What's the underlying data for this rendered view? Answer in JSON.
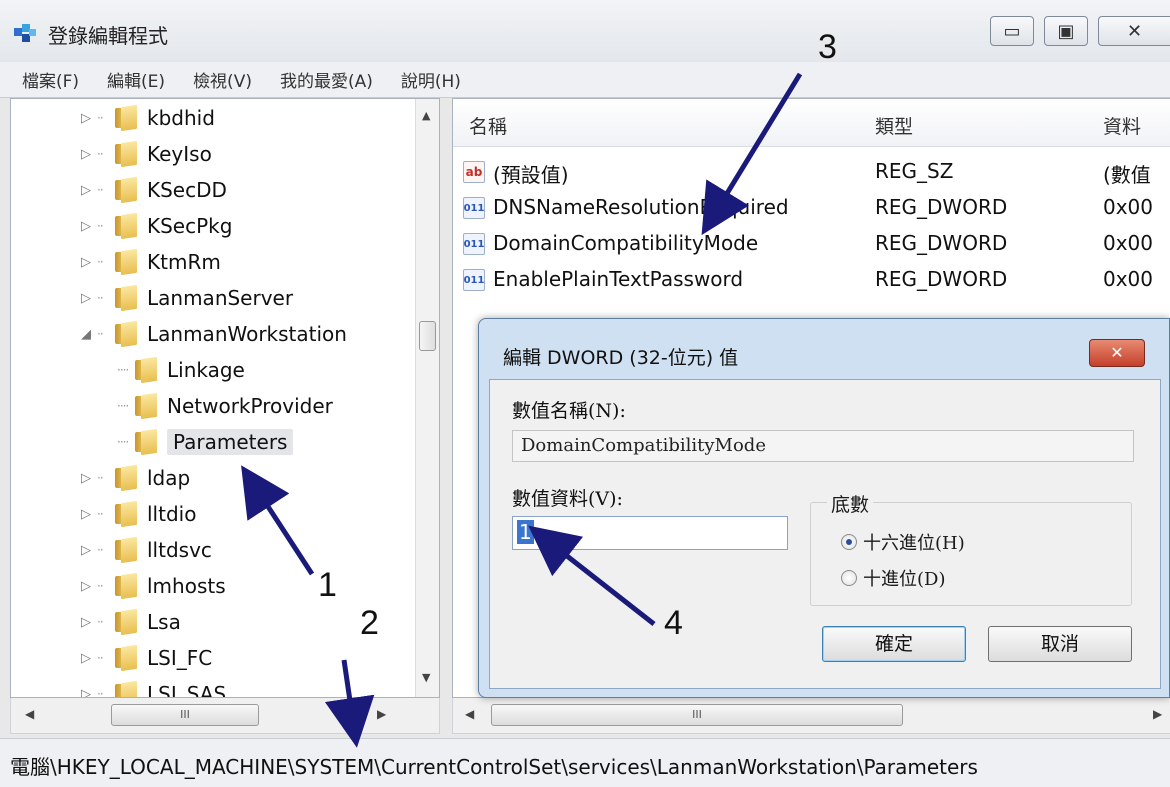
{
  "window": {
    "title": "登錄編輯程式",
    "controls": {
      "minimize": "▭",
      "maximize": "▣",
      "close": "✕"
    }
  },
  "menu": [
    "檔案(F)",
    "編輯(E)",
    "檢視(V)",
    "我的最愛(A)",
    "說明(H)"
  ],
  "tree": {
    "items": [
      {
        "label": "kbdhid",
        "expander": "▷"
      },
      {
        "label": "KeyIso",
        "expander": "▷"
      },
      {
        "label": "KSecDD",
        "expander": "▷"
      },
      {
        "label": "KSecPkg",
        "expander": "▷"
      },
      {
        "label": "KtmRm",
        "expander": "▷"
      },
      {
        "label": "LanmanServer",
        "expander": "▷"
      },
      {
        "label": "LanmanWorkstation",
        "expander": "◢"
      },
      {
        "label": "Linkage",
        "expander": ""
      },
      {
        "label": "NetworkProvider",
        "expander": ""
      },
      {
        "label": "Parameters",
        "expander": ""
      },
      {
        "label": "ldap",
        "expander": "▷"
      },
      {
        "label": "lltdio",
        "expander": "▷"
      },
      {
        "label": "lltdsvc",
        "expander": "▷"
      },
      {
        "label": "lmhosts",
        "expander": "▷"
      },
      {
        "label": "Lsa",
        "expander": "▷"
      },
      {
        "label": "LSI_FC",
        "expander": "▷"
      },
      {
        "label": "LSI_SAS",
        "expander": "▷"
      }
    ],
    "scroll_up": "▲",
    "scroll_down": "▼",
    "scroll_left": "◀",
    "scroll_right": "▶",
    "thumb_grip": "III"
  },
  "list": {
    "columns": {
      "name": "名稱",
      "type": "類型",
      "data": "資料"
    },
    "rows": [
      {
        "icon": "ab",
        "name": "(預設值)",
        "type": "REG_SZ",
        "data": "(數值"
      },
      {
        "icon": "011",
        "name": "DNSNameResolutionRequired",
        "type": "REG_DWORD",
        "data": "0x00"
      },
      {
        "icon": "011",
        "name": "DomainCompatibilityMode",
        "type": "REG_DWORD",
        "data": "0x00"
      },
      {
        "icon": "011",
        "name": "EnablePlainTextPassword",
        "type": "REG_DWORD",
        "data": "0x00"
      }
    ],
    "scroll_left": "◀",
    "scroll_right": "▶",
    "thumb_grip": "III"
  },
  "status": {
    "path": "電腦\\HKEY_LOCAL_MACHINE\\SYSTEM\\CurrentControlSet\\services\\LanmanWorkstation\\Parameters"
  },
  "dialog": {
    "title": "編輯 DWORD (32-位元) 值",
    "close": "✕",
    "name_label": "數值名稱(N):",
    "name_value": "DomainCompatibilityMode",
    "data_label": "數值資料(V):",
    "data_value": "1",
    "base_label": "底數",
    "radio_hex": "十六進位(H)",
    "radio_dec": "十進位(D)",
    "ok": "確定",
    "cancel": "取消"
  },
  "annotations": [
    "1",
    "2",
    "3",
    "4"
  ]
}
